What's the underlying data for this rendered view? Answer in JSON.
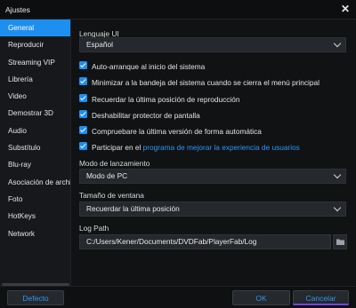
{
  "window": {
    "title": "Ajustes"
  },
  "sidebar": {
    "items": [
      {
        "label": "General",
        "active": true
      },
      {
        "label": "Reproducir",
        "active": false
      },
      {
        "label": "Streaming VIP",
        "active": false
      },
      {
        "label": "Librería",
        "active": false
      },
      {
        "label": "Video",
        "active": false
      },
      {
        "label": "Demostrar 3D",
        "active": false
      },
      {
        "label": "Audio",
        "active": false
      },
      {
        "label": "Substítulo",
        "active": false
      },
      {
        "label": "Blu-ray",
        "active": false
      },
      {
        "label": "Asociación de archiv",
        "active": false
      },
      {
        "label": "Foto",
        "active": false
      },
      {
        "label": "HotKeys",
        "active": false
      },
      {
        "label": "Network",
        "active": false
      }
    ]
  },
  "general": {
    "language_label": "Lenguaje UI",
    "language_value": "Español",
    "checkboxes": [
      {
        "label": "Auto-arranque al inicio del sistema",
        "checked": true
      },
      {
        "label": "Minimizar a la bandeja del sistema cuando se cierra el menú principal",
        "checked": true
      },
      {
        "label": "Recuerdar la última posición de reproducción",
        "checked": true
      },
      {
        "label": "Deshabilitar protector de pantalla",
        "checked": true
      },
      {
        "label": "Compruebare la última versión de forma automática",
        "checked": true
      }
    ],
    "participate": {
      "prefix": "Participar en el ",
      "link": "programa de mejorar la experiencia de usuarios",
      "checked": true
    },
    "launch_mode_label": "Modo de lanzamiento",
    "launch_mode_value": "Modo de PC",
    "window_size_label": "Tamaño de ventana",
    "window_size_value": "Recuerdar la última posición",
    "log_path_label": "Log Path",
    "log_path_value": "C:/Users/Kener/Documents/DVDFab/PlayerFab/Log"
  },
  "footer": {
    "default_label": "Defecto",
    "ok_label": "OK",
    "cancel_label": "Cancelar"
  },
  "colors": {
    "accent": "#1d8ff0",
    "link": "#2f97f5",
    "background": "#111214"
  },
  "icons": {
    "close": "close-icon",
    "folder": "folder-icon",
    "dropdown": "chevron-down-icon"
  }
}
